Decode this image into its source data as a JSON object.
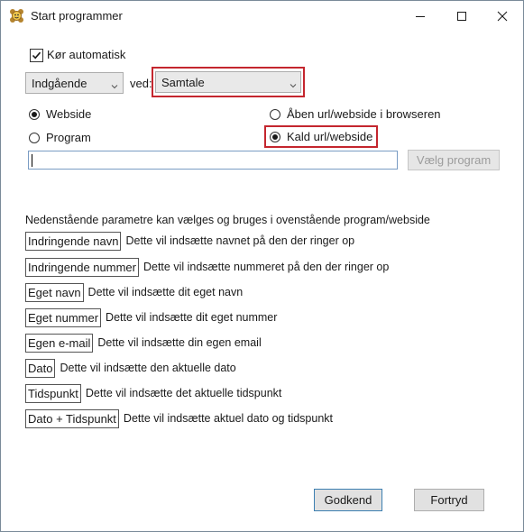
{
  "window": {
    "title": "Start programmer",
    "controls": [
      "minimize-icon",
      "maximize-icon",
      "close-icon"
    ]
  },
  "auto_run": {
    "label": "Kør automatisk",
    "checked": true
  },
  "direction_select": {
    "value": "Indgående"
  },
  "at_label": "ved:",
  "event_select": {
    "value": "Samtale"
  },
  "options": {
    "webside": {
      "label": "Webside",
      "checked": true
    },
    "program": {
      "label": "Program",
      "checked": false
    },
    "open_browser": {
      "label": "Åben url/webside i browseren",
      "checked": false
    },
    "call_url": {
      "label": "Kald url/webside",
      "checked": true
    }
  },
  "path_input": {
    "value": ""
  },
  "choose_program_button": "Vælg program",
  "params_intro": "Nedenstående parametre kan vælges og bruges i ovenstående program/webside",
  "params": [
    {
      "tag": "Indringende navn",
      "desc": "Dette vil indsætte navnet på den der ringer op"
    },
    {
      "tag": "Indringende nummer",
      "desc": "Dette vil indsætte nummeret på den der ringer op"
    },
    {
      "tag": "Eget navn",
      "desc": "Dette vil indsætte dit eget navn"
    },
    {
      "tag": "Eget nummer",
      "desc": "Dette vil indsætte dit eget nummer"
    },
    {
      "tag": "Egen e-mail",
      "desc": "Dette vil indsætte din egen email"
    },
    {
      "tag": "Dato",
      "desc": "Dette vil indsætte den aktuelle dato"
    },
    {
      "tag": "Tidspunkt",
      "desc": "Dette vil indsætte det aktuelle tidspunkt"
    },
    {
      "tag": "Dato + Tidspunkt",
      "desc": "Dette vil indsætte aktuel dato og tidspunkt"
    }
  ],
  "ok_button": "Godkend",
  "cancel_button": "Fortryd",
  "colors": {
    "highlight": "#c4262e",
    "button_face": "#e1e1e1",
    "accent": "#3c7fb1"
  }
}
